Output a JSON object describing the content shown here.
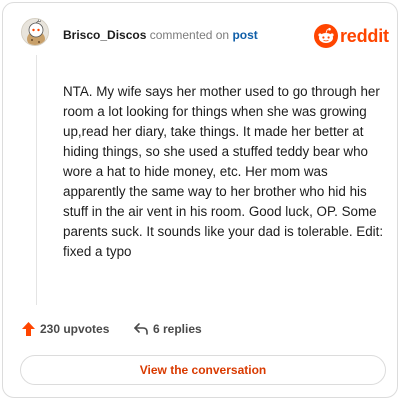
{
  "header": {
    "author": "Brisco_Discos",
    "action_text": "commented on",
    "post_link": "post",
    "logo_text": "reddit"
  },
  "comment": {
    "body": "NTA. My wife says her mother used to go through her room a lot looking for things when she was growing up,read her diary, take things. It made her better at hiding things, so she used a stuffed teddy bear who wore a hat to hide money, etc. Her mom was apparently the same way to her brother who hid his stuff in the air vent in his room. Good luck, OP. Some parents suck. It sounds like your dad is tolerable. Edit: fixed a typo"
  },
  "actions": {
    "upvotes": "230 upvotes",
    "replies": "6 replies"
  },
  "cta": {
    "label": "View the conversation"
  },
  "colors": {
    "brand": "#ff4500",
    "cta_text": "#d93a00",
    "link": "#0f5ea8"
  }
}
